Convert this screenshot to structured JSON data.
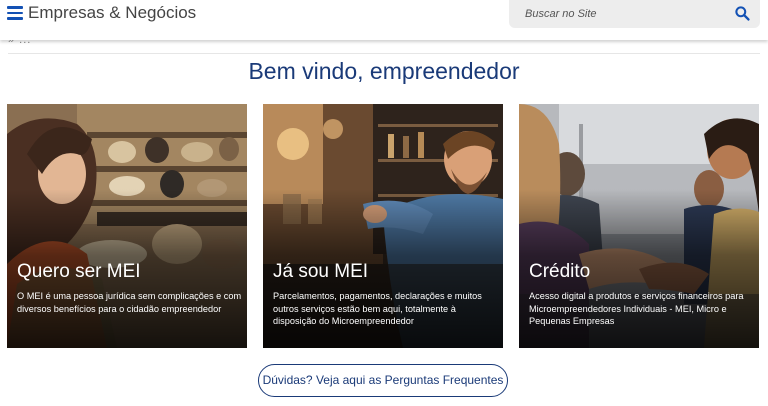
{
  "header": {
    "title": "Empresas & Negócios",
    "menu_icon": "hamburger-menu-icon",
    "search": {
      "placeholder": "Buscar no Site",
      "icon": "search-icon"
    }
  },
  "breadcrumb": {
    "glyph": "» ..."
  },
  "main": {
    "title": "Bem vindo, empreendedor",
    "cards": [
      {
        "title": "Quero ser MEI",
        "description": "O MEI é uma pessoa jurídica sem complicações e com diversos benefícios para o cidadão empreendedor"
      },
      {
        "title": "Já sou MEI",
        "description": "Parcelamentos, pagamentos, declarações e muitos outros serviços estão bem aqui, totalmente à disposição do Microempreendedor"
      },
      {
        "title": "Crédito",
        "description": "Acesso digital a produtos e serviços financeiros para Microempreendedores Individuais - MEI, Micro e Pequenas Empresas"
      }
    ],
    "faq_button": "Dúvidas? Veja aqui as Perguntas Frequentes"
  },
  "colors": {
    "brand_blue": "#1351b4",
    "title_navy": "#1a3a78",
    "search_bg": "#ededed"
  }
}
